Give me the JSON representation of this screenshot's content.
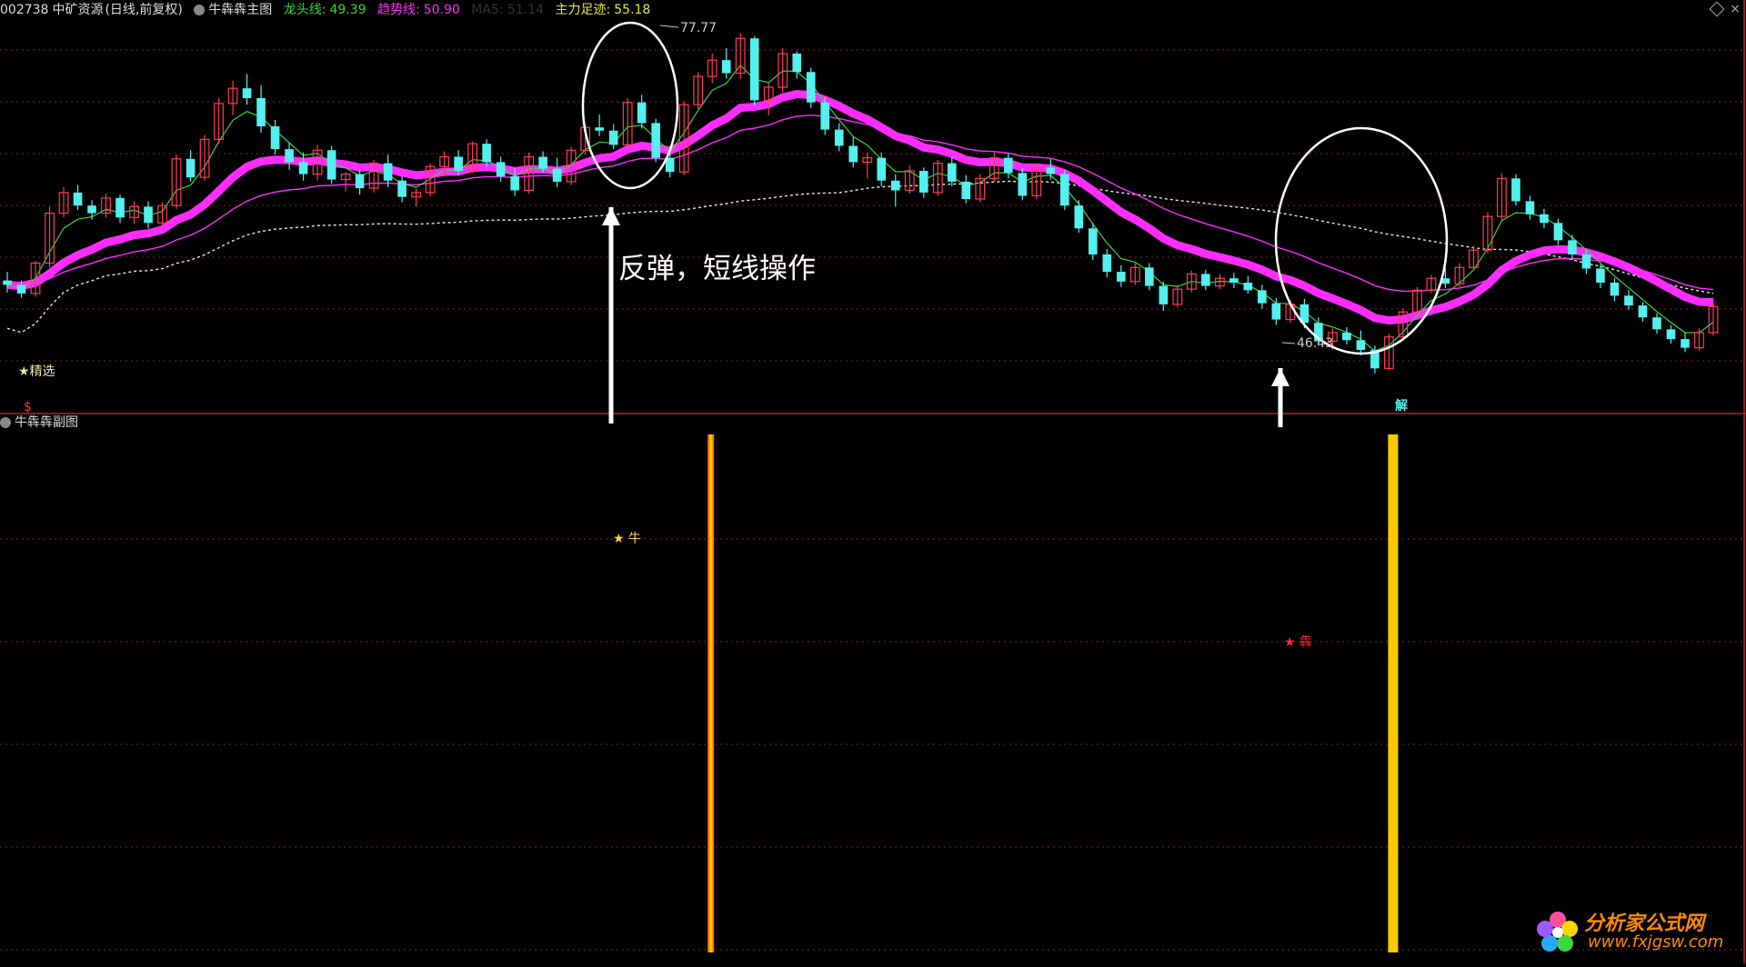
{
  "header": {
    "symbol": "002738",
    "name": "中矿资源",
    "period": "(日线,前复权)",
    "indicator_name": "牛犇犇主图",
    "longtou_label": "龙头线:",
    "longtou_value": "49.39",
    "trend_label": "趋势线:",
    "trend_value": "50.90",
    "ma_label": "MA5: 51.14",
    "zhuli_label": "主力足迹:",
    "zhuli_value": "55.18"
  },
  "sub_panel": {
    "title": "牛犇犇副图"
  },
  "annotations": {
    "main_note": "反弹，短线操作",
    "high_label": "77.77",
    "low_label": "46.43",
    "jingxuan": "★精选",
    "buy_mark": "$",
    "jie_mark": "解",
    "niu_label": "★ 牛",
    "ben_label": "★ 犇"
  },
  "watermark": {
    "title": "分析家公式网",
    "url": "www.fxjgsw.com"
  },
  "colors": {
    "up": "#ff3a5a",
    "down": "#54f0f0",
    "trend": "#ff2cff",
    "longtou": "#d0d0ff",
    "dash": "#e8e8e8",
    "accent": "#e8e840",
    "bar": "#ffc800",
    "grid": "#8a2020"
  },
  "chart_data": {
    "type": "candlestick",
    "ylim": [
      44,
      80
    ],
    "high": 77.77,
    "low": 46.43,
    "candles": [
      [
        55.0,
        55.8,
        53.9,
        54.6
      ],
      [
        54.6,
        55.0,
        53.4,
        53.8
      ],
      [
        53.8,
        56.8,
        53.5,
        56.6
      ],
      [
        56.6,
        61.8,
        56.2,
        61.2
      ],
      [
        61.2,
        63.6,
        60.8,
        63.1
      ],
      [
        63.1,
        63.8,
        61.5,
        61.9
      ],
      [
        61.9,
        62.4,
        60.6,
        61.2
      ],
      [
        61.2,
        63.0,
        60.8,
        62.6
      ],
      [
        62.6,
        62.9,
        60.3,
        60.8
      ],
      [
        60.8,
        62.3,
        60.2,
        61.8
      ],
      [
        61.8,
        62.3,
        59.8,
        60.3
      ],
      [
        60.3,
        62.2,
        60.0,
        61.9
      ],
      [
        61.9,
        66.6,
        61.6,
        66.2
      ],
      [
        66.2,
        67.0,
        64.1,
        64.5
      ],
      [
        64.5,
        68.4,
        64.2,
        68.0
      ],
      [
        68.0,
        71.8,
        67.6,
        71.3
      ],
      [
        71.3,
        73.4,
        70.2,
        72.7
      ],
      [
        72.7,
        74.0,
        71.2,
        71.8
      ],
      [
        71.8,
        73.0,
        68.6,
        69.2
      ],
      [
        69.2,
        69.8,
        66.6,
        67.1
      ],
      [
        67.1,
        67.7,
        65.2,
        65.9
      ],
      [
        65.9,
        66.8,
        64.2,
        64.8
      ],
      [
        64.8,
        67.5,
        64.2,
        67.0
      ],
      [
        67.0,
        67.4,
        63.9,
        64.3
      ],
      [
        64.3,
        65.0,
        63.2,
        64.8
      ],
      [
        64.8,
        65.2,
        62.9,
        63.5
      ],
      [
        63.5,
        66.1,
        63.1,
        65.8
      ],
      [
        65.8,
        66.6,
        63.6,
        64.2
      ],
      [
        64.2,
        64.6,
        62.2,
        62.7
      ],
      [
        62.7,
        63.5,
        61.8,
        63.1
      ],
      [
        63.1,
        65.8,
        62.8,
        65.5
      ],
      [
        65.5,
        66.9,
        64.8,
        66.4
      ],
      [
        66.4,
        67.0,
        64.7,
        65.1
      ],
      [
        65.1,
        67.8,
        64.9,
        67.6
      ],
      [
        67.6,
        68.0,
        65.5,
        65.9
      ],
      [
        65.9,
        66.4,
        64.1,
        64.6
      ],
      [
        64.6,
        65.3,
        62.8,
        63.3
      ],
      [
        63.3,
        66.8,
        63.0,
        66.4
      ],
      [
        66.4,
        66.9,
        64.9,
        65.3
      ],
      [
        65.3,
        66.3,
        63.6,
        64.1
      ],
      [
        64.1,
        67.3,
        63.8,
        67.0
      ],
      [
        67.0,
        69.4,
        66.6,
        69.1
      ],
      [
        69.1,
        70.3,
        68.3,
        68.8
      ],
      [
        68.8,
        69.4,
        67.1,
        67.5
      ],
      [
        67.5,
        71.8,
        67.2,
        71.4
      ],
      [
        71.4,
        72.1,
        69.0,
        69.5
      ],
      [
        69.5,
        69.9,
        65.9,
        66.3
      ],
      [
        66.3,
        66.9,
        64.5,
        65.0
      ],
      [
        65.0,
        71.5,
        64.7,
        71.2
      ],
      [
        71.2,
        74.2,
        70.8,
        73.8
      ],
      [
        73.8,
        75.9,
        73.2,
        75.3
      ],
      [
        75.3,
        76.4,
        73.6,
        74.1
      ],
      [
        74.1,
        77.77,
        73.6,
        77.3
      ],
      [
        77.3,
        77.5,
        71.1,
        71.6
      ],
      [
        71.6,
        73.2,
        70.2,
        72.8
      ],
      [
        72.8,
        76.4,
        72.3,
        75.9
      ],
      [
        75.9,
        76.1,
        73.6,
        74.2
      ],
      [
        74.2,
        74.6,
        70.9,
        71.4
      ],
      [
        71.4,
        71.9,
        68.4,
        68.9
      ],
      [
        68.9,
        69.5,
        66.9,
        67.4
      ],
      [
        67.4,
        68.2,
        65.4,
        65.9
      ],
      [
        65.9,
        66.8,
        64.4,
        66.3
      ],
      [
        66.3,
        66.8,
        63.7,
        64.2
      ],
      [
        64.2,
        64.8,
        61.8,
        63.3
      ],
      [
        63.3,
        65.6,
        63.0,
        65.1
      ],
      [
        65.1,
        65.4,
        62.6,
        63.1
      ],
      [
        63.1,
        66.1,
        62.8,
        65.8
      ],
      [
        65.8,
        66.4,
        63.7,
        64.1
      ],
      [
        64.1,
        64.7,
        62.1,
        62.5
      ],
      [
        62.5,
        64.8,
        62.2,
        64.4
      ],
      [
        64.4,
        66.8,
        64.1,
        66.3
      ],
      [
        66.3,
        66.7,
        64.4,
        64.9
      ],
      [
        64.9,
        65.3,
        62.4,
        62.8
      ],
      [
        62.8,
        65.8,
        62.5,
        65.4
      ],
      [
        65.4,
        66.2,
        64.3,
        64.8
      ],
      [
        64.8,
        65.2,
        61.5,
        61.9
      ],
      [
        61.9,
        62.4,
        59.4,
        59.8
      ],
      [
        59.8,
        60.3,
        56.9,
        57.4
      ],
      [
        57.4,
        57.9,
        55.3,
        55.8
      ],
      [
        55.8,
        56.4,
        54.4,
        54.9
      ],
      [
        54.9,
        56.6,
        54.6,
        56.2
      ],
      [
        56.2,
        56.6,
        54.1,
        54.5
      ],
      [
        54.5,
        54.9,
        52.2,
        52.8
      ],
      [
        52.8,
        54.6,
        52.5,
        54.2
      ],
      [
        54.2,
        55.9,
        53.9,
        55.6
      ],
      [
        55.6,
        56.0,
        54.1,
        54.5
      ],
      [
        54.5,
        55.6,
        54.2,
        55.2
      ],
      [
        55.2,
        55.7,
        54.3,
        54.8
      ],
      [
        54.8,
        55.4,
        53.8,
        54.1
      ],
      [
        54.1,
        54.6,
        52.4,
        52.9
      ],
      [
        52.9,
        53.4,
        50.9,
        51.4
      ],
      [
        51.4,
        53.2,
        51.1,
        52.8
      ],
      [
        52.8,
        53.3,
        50.6,
        51.1
      ],
      [
        51.1,
        51.6,
        49.0,
        49.4
      ],
      [
        49.4,
        50.6,
        48.6,
        50.2
      ],
      [
        50.2,
        50.7,
        49.1,
        49.5
      ],
      [
        49.5,
        50.4,
        48.1,
        48.6
      ],
      [
        48.6,
        49.0,
        46.43,
        46.9
      ],
      [
        46.9,
        50.1,
        46.7,
        49.8
      ],
      [
        49.8,
        52.4,
        49.5,
        52.1
      ],
      [
        52.1,
        54.4,
        51.8,
        54.1
      ],
      [
        54.1,
        55.5,
        53.8,
        55.2
      ],
      [
        55.2,
        56.2,
        54.3,
        54.7
      ],
      [
        54.7,
        56.6,
        54.4,
        56.2
      ],
      [
        56.2,
        58.2,
        55.9,
        57.8
      ],
      [
        57.8,
        61.3,
        57.5,
        60.9
      ],
      [
        60.9,
        64.9,
        60.6,
        64.4
      ],
      [
        64.4,
        64.8,
        61.9,
        62.3
      ],
      [
        62.3,
        62.8,
        60.6,
        61.1
      ],
      [
        61.1,
        61.6,
        59.8,
        60.3
      ],
      [
        60.3,
        60.7,
        58.3,
        58.7
      ],
      [
        58.7,
        59.2,
        56.9,
        57.4
      ],
      [
        57.4,
        57.8,
        55.6,
        56.1
      ],
      [
        56.1,
        56.5,
        54.3,
        54.8
      ],
      [
        54.8,
        55.2,
        53.1,
        53.6
      ],
      [
        53.6,
        54.1,
        52.3,
        52.7
      ],
      [
        52.7,
        53.0,
        51.2,
        51.6
      ],
      [
        51.6,
        52.0,
        50.1,
        50.5
      ],
      [
        50.5,
        50.9,
        49.2,
        49.6
      ],
      [
        49.6,
        50.2,
        48.4,
        48.8
      ],
      [
        48.8,
        50.6,
        48.5,
        50.2
      ],
      [
        50.2,
        52.9,
        49.9,
        52.6
      ]
    ]
  }
}
